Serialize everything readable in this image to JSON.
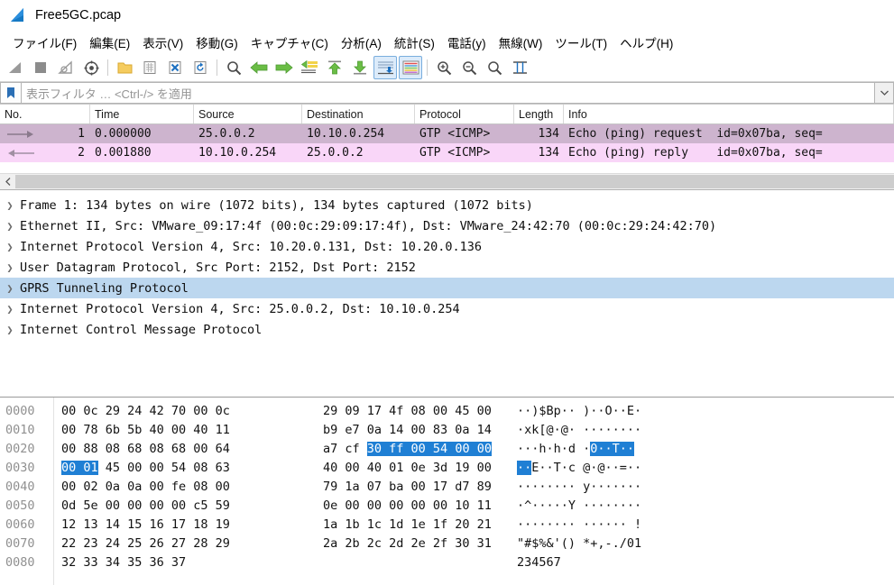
{
  "window": {
    "title": "Free5GC.pcap",
    "icon": "wireshark-fin-icon"
  },
  "menubar": {
    "items": [
      {
        "label": "ファイル(F)",
        "name": "menu-file"
      },
      {
        "label": "編集(E)",
        "name": "menu-edit"
      },
      {
        "label": "表示(V)",
        "name": "menu-view"
      },
      {
        "label": "移動(G)",
        "name": "menu-go"
      },
      {
        "label": "キャプチャ(C)",
        "name": "menu-capture"
      },
      {
        "label": "分析(A)",
        "name": "menu-analyze"
      },
      {
        "label": "統計(S)",
        "name": "menu-statistics"
      },
      {
        "label": "電話(y)",
        "name": "menu-telephony"
      },
      {
        "label": "無線(W)",
        "name": "menu-wireless"
      },
      {
        "label": "ツール(T)",
        "name": "menu-tools"
      },
      {
        "label": "ヘルプ(H)",
        "name": "menu-help"
      }
    ]
  },
  "toolbar": {
    "buttons": [
      "start-capture-icon",
      "stop-capture-icon",
      "restart-capture-icon",
      "capture-options-icon",
      "open-file-icon",
      "save-file-icon",
      "close-file-icon",
      "reload-file-icon",
      "find-packet-icon",
      "go-back-icon",
      "go-forward-icon",
      "go-to-packet-icon",
      "go-to-first-icon",
      "go-to-last-icon",
      "auto-scroll-icon",
      "colorize-icon",
      "zoom-in-icon",
      "zoom-out-icon",
      "zoom-reset-icon",
      "resize-columns-icon"
    ]
  },
  "filter": {
    "bookmark_icon": "bookmark-icon",
    "placeholder": "表示フィルタ … <Ctrl-/> を適用",
    "value": "",
    "dropdown_icon": "chevron-down-icon"
  },
  "packet_list": {
    "columns": [
      {
        "label": "No.",
        "name": "column-no"
      },
      {
        "label": "Time",
        "name": "column-time"
      },
      {
        "label": "Source",
        "name": "column-source"
      },
      {
        "label": "Destination",
        "name": "column-destination"
      },
      {
        "label": "Protocol",
        "name": "column-protocol"
      },
      {
        "label": "Length",
        "name": "column-length"
      },
      {
        "label": "Info",
        "name": "column-info"
      }
    ],
    "rows": [
      {
        "direction_icon": "arrow-right-icon",
        "no": "1",
        "time": "0.000000",
        "source": "25.0.0.2",
        "destination": "10.10.0.254",
        "protocol": "GTP <ICMP>",
        "length": "134",
        "info": "Echo (ping) request  id=0x07ba, seq="
      },
      {
        "direction_icon": "arrow-left-icon",
        "no": "2",
        "time": "0.001880",
        "source": "10.10.0.254",
        "destination": "25.0.0.2",
        "protocol": "GTP <ICMP>",
        "length": "134",
        "info": "Echo (ping) reply    id=0x07ba, seq="
      }
    ],
    "scroll_left_icon": "chevron-left-icon"
  },
  "detail_tree": {
    "rows": [
      {
        "text": "Frame 1: 134 bytes on wire (1072 bits), 134 bytes captured (1072 bits)",
        "selected": false,
        "name": "tree-item-frame"
      },
      {
        "text": "Ethernet II, Src: VMware_09:17:4f (00:0c:29:09:17:4f), Dst: VMware_24:42:70 (00:0c:29:24:42:70)",
        "selected": false,
        "name": "tree-item-ethernet"
      },
      {
        "text": "Internet Protocol Version 4, Src: 10.20.0.131, Dst: 10.20.0.136",
        "selected": false,
        "name": "tree-item-ipv4-outer"
      },
      {
        "text": "User Datagram Protocol, Src Port: 2152, Dst Port: 2152",
        "selected": false,
        "name": "tree-item-udp"
      },
      {
        "text": "GPRS Tunneling Protocol",
        "selected": true,
        "name": "tree-item-gtp"
      },
      {
        "text": "Internet Protocol Version 4, Src: 25.0.0.2, Dst: 10.10.0.254",
        "selected": false,
        "name": "tree-item-ipv4-inner"
      },
      {
        "text": "Internet Control Message Protocol",
        "selected": false,
        "name": "tree-item-icmp"
      }
    ],
    "twisty_icon": "chevron-right-icon"
  },
  "hex_pane": {
    "rows": [
      {
        "offset": "0000",
        "group1": "00 0c 29 24 42 70 00 0c",
        "group2": "29 09 17 4f 08 00 45 00",
        "ascii": "··)$Bp·· )··O··E·",
        "hl": null
      },
      {
        "offset": "0010",
        "group1": "00 78 6b 5b 40 00 40 11",
        "group2": "b9 e7 0a 14 00 83 0a 14",
        "ascii": "·xk[@·@· ········",
        "hl": null
      },
      {
        "offset": "0020",
        "group1": "00 88 08 68 08 68 00 64",
        "group2_pre": "a7 cf ",
        "group2_hl": "30 ff 00 54 00 00",
        "ascii_pre": "···h·h·d ·",
        "ascii_hl": "0··T··",
        "ascii_post": ""
      },
      {
        "offset": "0030",
        "group1_hl": "00 01",
        "group1_post": " 45 00 00 54 08 63",
        "group2": "40 00 40 01 0e 3d 19 00",
        "ascii_hl": "··",
        "ascii_post": "E··T·c @·@··=··"
      },
      {
        "offset": "0040",
        "group1": "00 02 0a 0a 00 fe 08 00",
        "group2": "79 1a 07 ba 00 17 d7 89",
        "ascii": "········ y·······",
        "hl": null
      },
      {
        "offset": "0050",
        "group1": "0d 5e 00 00 00 00 c5 59",
        "group2": "0e 00 00 00 00 00 10 11",
        "ascii": "·^·····Y ········",
        "hl": null
      },
      {
        "offset": "0060",
        "group1": "12 13 14 15 16 17 18 19",
        "group2": "1a 1b 1c 1d 1e 1f 20 21",
        "ascii": "········ ······ !",
        "hl": null
      },
      {
        "offset": "0070",
        "group1": "22 23 24 25 26 27 28 29",
        "group2": "2a 2b 2c 2d 2e 2f 30 31",
        "ascii": "\"#$%&'() *+,-./01",
        "hl": null
      },
      {
        "offset": "0080",
        "group1": "32 33 34 35 36 37",
        "group2": "",
        "ascii": "234567",
        "hl": null
      }
    ]
  },
  "colors": {
    "selected_row": "#cdb4ce",
    "alt_row": "#f9d6f8",
    "tree_selected": "#bcd7ef",
    "hex_highlight": "#1f7fd4",
    "toolbar_active": "#dcebfa"
  }
}
